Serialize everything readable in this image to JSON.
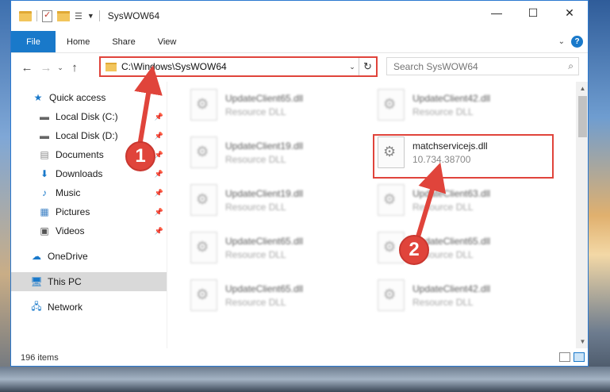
{
  "window": {
    "title": "SysWOW64"
  },
  "ribbon": {
    "tabs": [
      "File",
      "Home",
      "Share",
      "View"
    ]
  },
  "address": {
    "path": "C:\\Windows\\SysWOW64"
  },
  "search": {
    "placeholder": "Search SysWOW64"
  },
  "sidebar": {
    "items": [
      {
        "label": "Quick access",
        "icon": "star-icon"
      },
      {
        "label": "Local Disk (C:)",
        "icon": "drive-icon",
        "pinned": true
      },
      {
        "label": "Local Disk (D:)",
        "icon": "drive-icon",
        "pinned": true
      },
      {
        "label": "Documents",
        "icon": "documents-icon",
        "pinned": true
      },
      {
        "label": "Downloads",
        "icon": "download-icon",
        "pinned": true
      },
      {
        "label": "Music",
        "icon": "music-icon",
        "pinned": true
      },
      {
        "label": "Pictures",
        "icon": "pictures-icon",
        "pinned": true
      },
      {
        "label": "Videos",
        "icon": "videos-icon",
        "pinned": true
      },
      {
        "label": "OneDrive",
        "icon": "onedrive-icon"
      },
      {
        "label": "This PC",
        "icon": "computer-icon",
        "selected": true
      },
      {
        "label": "Network",
        "icon": "network-icon"
      }
    ]
  },
  "files": [
    {
      "name": "UpdateClient65.dll",
      "sub": "Resource DLL"
    },
    {
      "name": "UpdateClient42.dll",
      "sub": "Resource DLL"
    },
    {
      "name": "UpdateClient19.dll",
      "sub": "Resource DLL"
    },
    {
      "name": "matchservicejs.dll",
      "sub": "10.734.38700"
    },
    {
      "name": "UpdateClient19.dll",
      "sub": "Resource DLL"
    },
    {
      "name": "UpdateClient63.dll",
      "sub": "Resource DLL"
    },
    {
      "name": "UpdateClient65.dll",
      "sub": "Resource DLL"
    },
    {
      "name": "UpdateClient65.dll",
      "sub": "Resource DLL"
    },
    {
      "name": "UpdateClient65.dll",
      "sub": "Resource DLL"
    },
    {
      "name": "UpdateClient42.dll",
      "sub": "Resource DLL"
    }
  ],
  "status": {
    "count": "196 items"
  },
  "annotations": {
    "step1": "1",
    "step2": "2",
    "color": "#e0443b"
  }
}
